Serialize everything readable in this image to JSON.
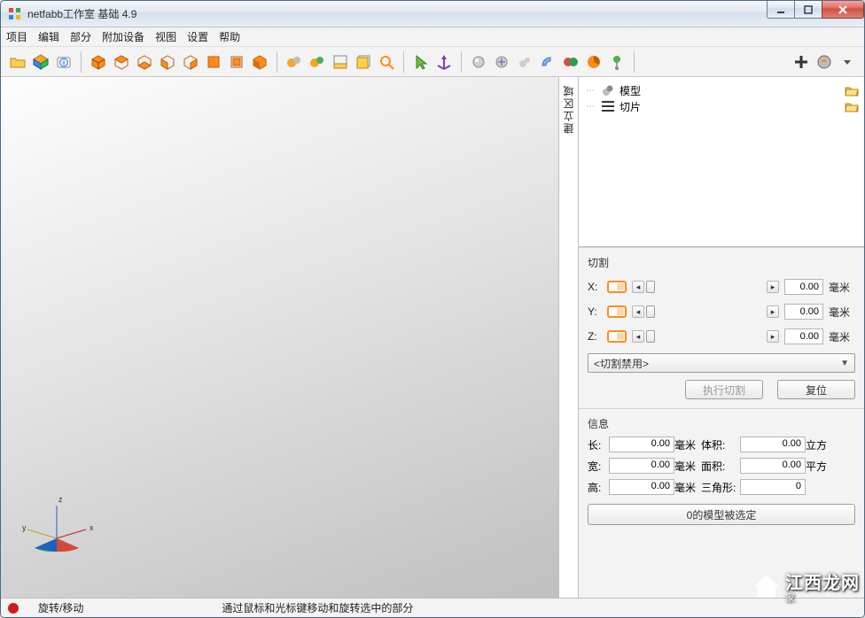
{
  "window": {
    "title": "netfabb工作室 基础 4.9"
  },
  "menubar": {
    "project": "项目",
    "edit": "编辑",
    "part": "部分",
    "extras": "附加设备",
    "view": "视图",
    "settings": "设置",
    "help": "帮助"
  },
  "viewport": {
    "context_tab": "建立区域",
    "axis": {
      "x": "x",
      "y": "y",
      "z": "z"
    }
  },
  "tree": {
    "models": "模型",
    "slices": "切片"
  },
  "cut": {
    "title": "切割",
    "unit": "毫米",
    "x": {
      "label": "X:",
      "value": "0.00"
    },
    "y": {
      "label": "Y:",
      "value": "0.00"
    },
    "z": {
      "label": "Z:",
      "value": "0.00"
    },
    "mode_selected": "<切割禁用>",
    "execute_label": "执行切割",
    "reset_label": "复位"
  },
  "info": {
    "title": "信息",
    "length": {
      "label": "长:",
      "value": "0.00",
      "unit": "毫米"
    },
    "width": {
      "label": "宽:",
      "value": "0.00",
      "unit": "毫米"
    },
    "height": {
      "label": "高:",
      "value": "0.00",
      "unit": "毫米"
    },
    "volume": {
      "label": "体积:",
      "value": "0.00",
      "unit": "立方"
    },
    "area": {
      "label": "面积:",
      "value": "0.00",
      "unit": "平方"
    },
    "triangles": {
      "label": "三角形:",
      "value": "0"
    },
    "selection_status": "0的模型被选定"
  },
  "status": {
    "mode": "旋转/移动",
    "hint": "通过鼠标和光标键移动和旋转选中的部分"
  },
  "watermark": {
    "main": "江西龙网",
    "sub": "家"
  },
  "colors": {
    "accent_orange": "#ff8c1a",
    "status_red": "#d21b1b"
  }
}
